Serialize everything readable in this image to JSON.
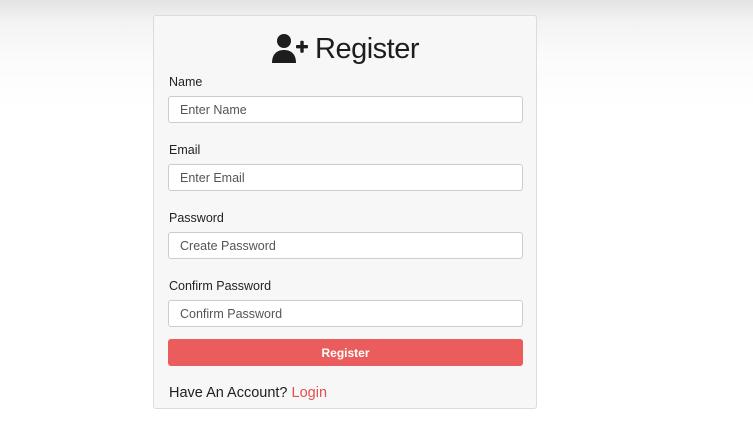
{
  "header": {
    "title": "Register",
    "icon": "user-plus-icon"
  },
  "form": {
    "name": {
      "label": "Name",
      "placeholder": "Enter Name"
    },
    "email": {
      "label": "Email",
      "placeholder": "Enter Email"
    },
    "password": {
      "label": "Password",
      "placeholder": "Create Password"
    },
    "confirm": {
      "label": "Confirm Password",
      "placeholder": "Confirm Password"
    },
    "submit_label": "Register"
  },
  "footer": {
    "prompt": "Have An Account?",
    "link_label": "Login"
  },
  "colors": {
    "accent": "#eb5c5d",
    "link": "#e4504f"
  }
}
